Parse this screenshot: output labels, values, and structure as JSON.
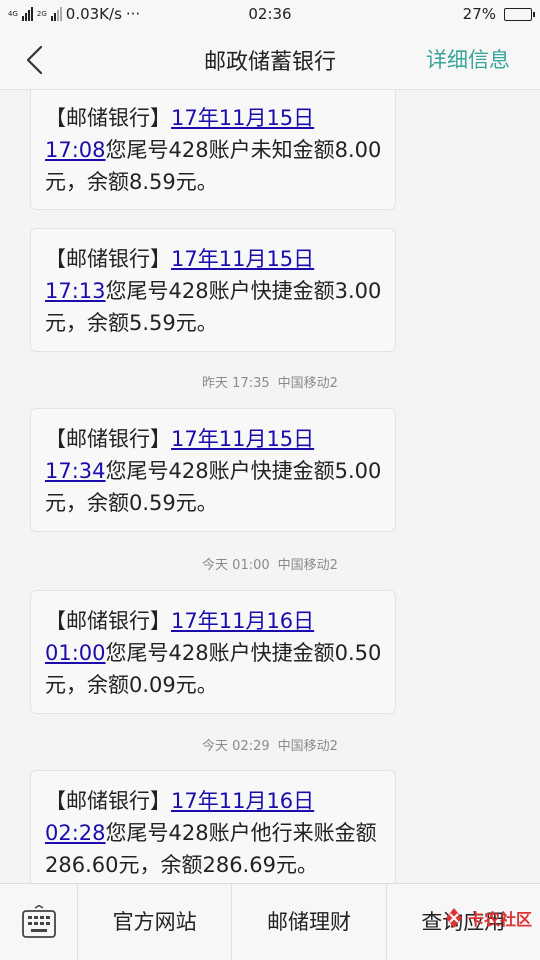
{
  "status_bar": {
    "net_label_1": "4G",
    "net_label_2": "2G",
    "speed": "0.03K/s",
    "dots": "···",
    "time": "02:36",
    "battery_percent": "27%",
    "battery_level": 0.27
  },
  "header": {
    "title": "邮政储蓄银行",
    "detail_link": "详细信息"
  },
  "messages": [
    {
      "prefix": "【邮储银行】",
      "date": "17年11月15日",
      "time": "17:08",
      "text": "您尾号428账户未知金额8.00元，余额8.59元。"
    },
    {
      "prefix": "【邮储银行】",
      "date": "17年11月15日",
      "time": "17:13",
      "text": "您尾号428账户快捷金额3.00元，余额5.59元。"
    },
    {
      "prefix": "【邮储银行】",
      "date": "17年11月15日",
      "time": "17:34",
      "text": "您尾号428账户快捷金额5.00元，余额0.59元。"
    },
    {
      "prefix": "【邮储银行】",
      "date": "17年11月16日",
      "time": "01:00",
      "text": "您尾号428账户快捷金额0.50元，余额0.09元。"
    },
    {
      "prefix": "【邮储银行】",
      "date": "17年11月16日",
      "time": "02:28",
      "text": "您尾号428账户他行来账金额286.60元，余额286.69元。"
    }
  ],
  "timestamps": [
    {
      "when": "昨天  17:35",
      "carrier": "中国移动2"
    },
    {
      "when": "今天  01:00",
      "carrier": "中国移动2"
    },
    {
      "when": "今天  02:29",
      "carrier": "中国移动2"
    }
  ],
  "bottom_bar": {
    "items": [
      "官方网站",
      "邮储理财",
      "查询应用"
    ]
  },
  "watermark": {
    "text": "卡农社区"
  },
  "colors": {
    "accent": "#3aa59a",
    "link": "#1a0dab",
    "meta_text": "#8a8a8a"
  }
}
